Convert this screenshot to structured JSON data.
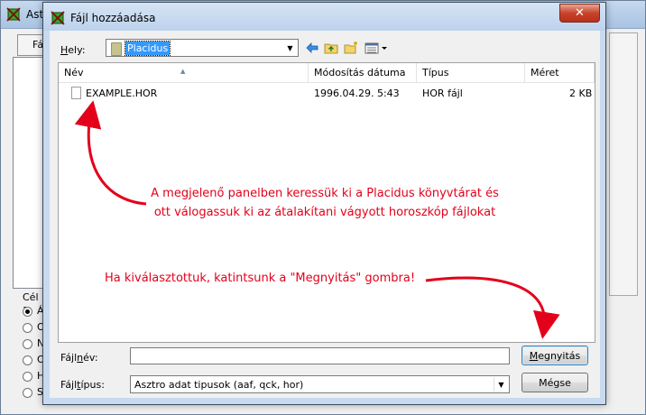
{
  "background_window": {
    "title": "Astr",
    "tab_label": "Fá",
    "group_label": "Cél a",
    "radio_labels": [
      "Á",
      "O",
      "N",
      "O",
      "H",
      "S"
    ]
  },
  "dialog": {
    "title": "Fájl hozzáadása",
    "close_label": "✕",
    "location": {
      "label_prefix": "",
      "label_accesskey": "H",
      "label_rest": "ely:",
      "value": "Placidus"
    },
    "toolbar_icons": [
      "back-arrow-icon",
      "up-folder-icon",
      "new-folder-icon",
      "view-menu-icon"
    ],
    "columns": [
      {
        "key": "name",
        "label": "Név"
      },
      {
        "key": "modified",
        "label": "Módosítás dátuma"
      },
      {
        "key": "type",
        "label": "Típus"
      },
      {
        "key": "size",
        "label": "Méret"
      }
    ],
    "files": [
      {
        "name": "EXAMPLE.HOR",
        "modified": "1996.04.29. 5:43",
        "type": "HOR fájl",
        "size": "2 KB"
      }
    ],
    "filename": {
      "label_prefix": "Fájl",
      "label_accesskey": "n",
      "label_rest": "év:",
      "value": ""
    },
    "filetype": {
      "label_prefix": "Fájl",
      "label_accesskey": "t",
      "label_rest": "ípus:",
      "value": "Asztro adat tipusok (aaf, qck, hor)"
    },
    "open_button": {
      "prefix": "",
      "accesskey": "M",
      "rest": "egnyitás"
    },
    "cancel_button": {
      "label": "Mégse"
    }
  },
  "annotations": {
    "text1_line1": "A megjelenő panelben keressük ki a Placidus könyvtárat és",
    "text1_line2": "ott válogassuk ki az átalakítani vágyott horoszkóp fájlokat",
    "text2": "Ha kiválasztottuk, katintsunk a \"Megnyitás\" gombra!",
    "color": "#e3001b"
  },
  "colors": {
    "accent": "#3399ff",
    "close": "#c7432a",
    "titlebar": "#c8daef"
  }
}
